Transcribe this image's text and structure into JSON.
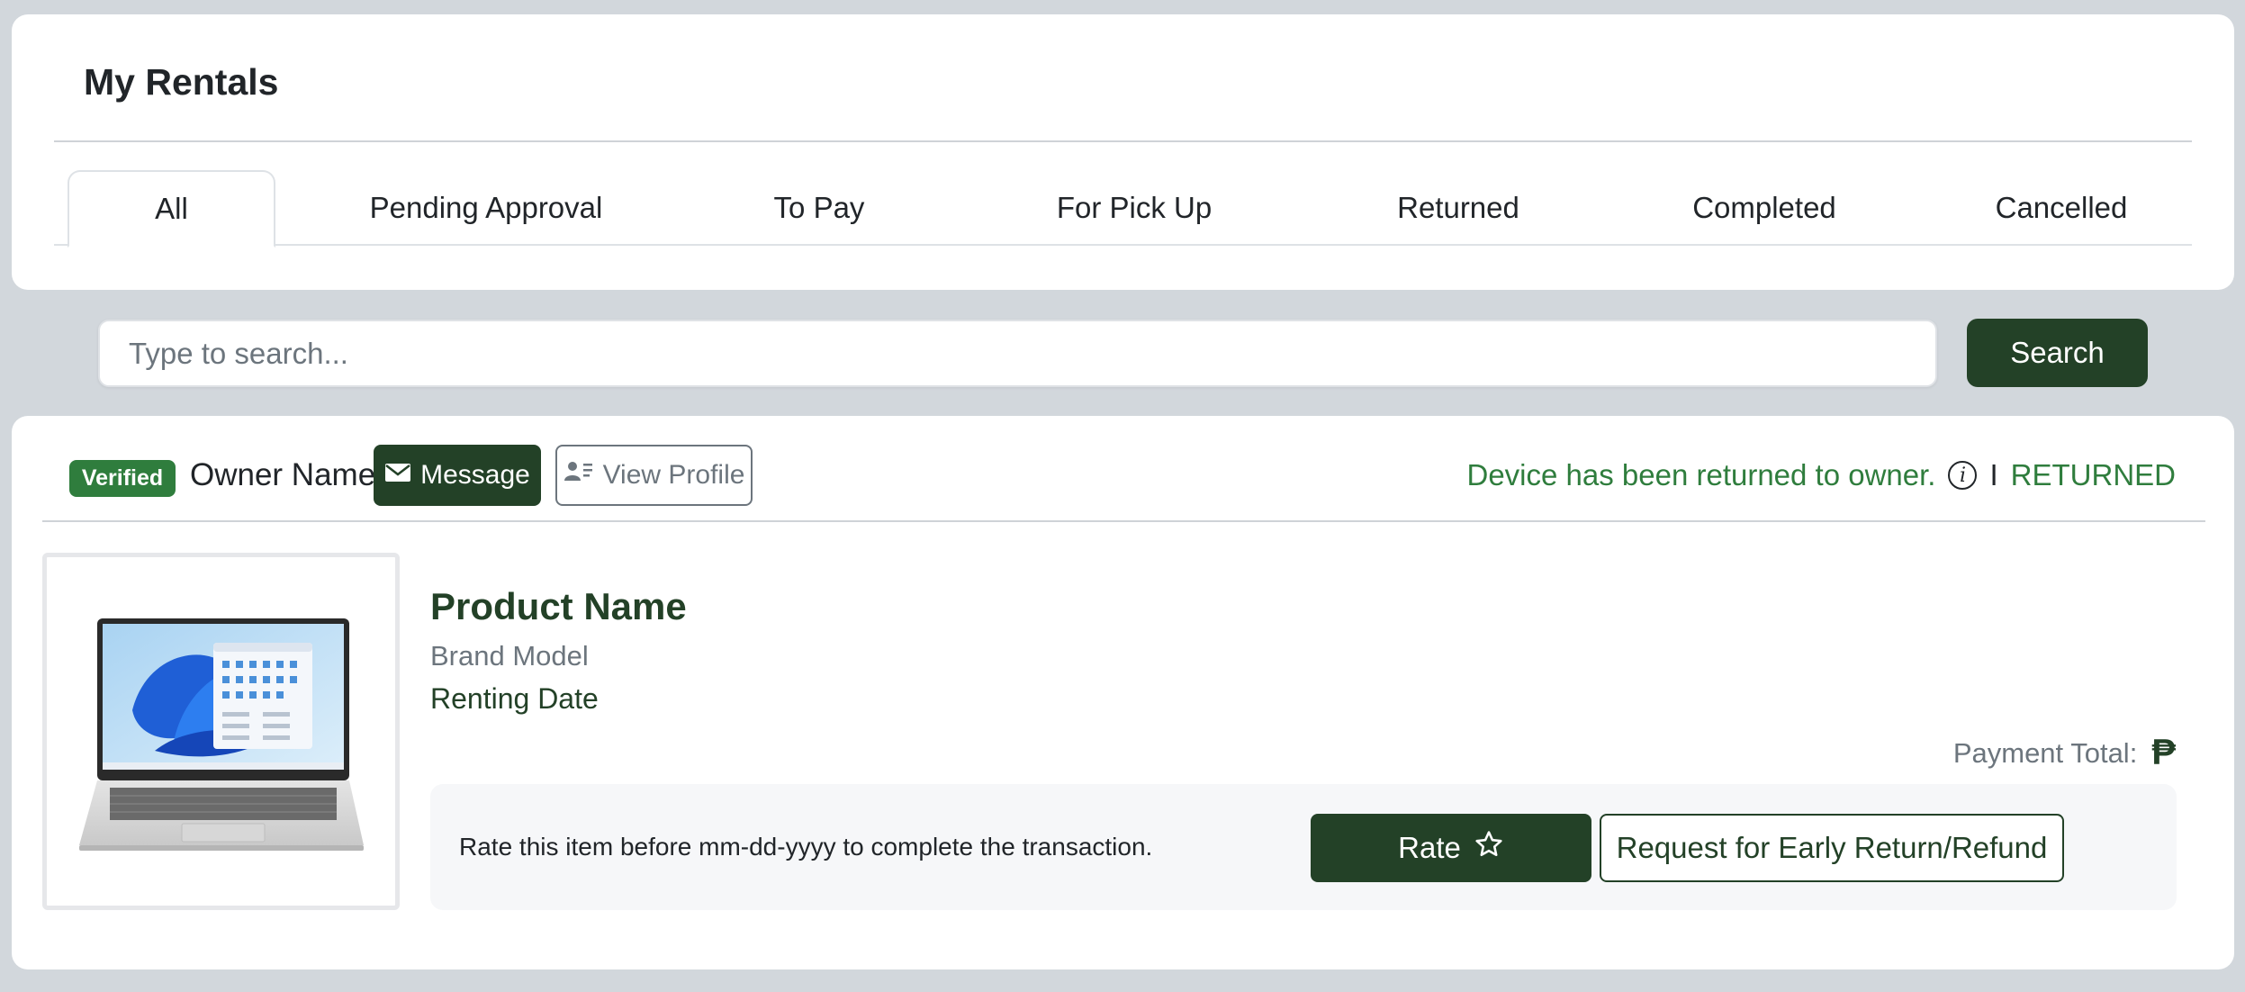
{
  "header": {
    "title": "My Rentals"
  },
  "tabs": [
    {
      "label": "All",
      "active": true
    },
    {
      "label": "Pending Approval",
      "active": false
    },
    {
      "label": "To Pay",
      "active": false
    },
    {
      "label": "For Pick Up",
      "active": false
    },
    {
      "label": "Returned",
      "active": false
    },
    {
      "label": "Completed",
      "active": false
    },
    {
      "label": "Cancelled",
      "active": false
    }
  ],
  "search": {
    "placeholder": "Type to search...",
    "button_label": "Search"
  },
  "rental": {
    "badge": "Verified",
    "owner_name": "Owner Name",
    "message_label": "Message",
    "view_profile_label": "View Profile",
    "status_message": "Device has been returned to owner.",
    "separator": "I",
    "status": "RETURNED",
    "product_name": "Product Name",
    "brand_model": "Brand Model",
    "renting_date": "Renting Date",
    "payment_label": "Payment Total:",
    "currency_symbol": "₱",
    "rate_prompt": "Rate this item before mm-dd-yyyy to complete the transaction.",
    "rate_label": "Rate",
    "refund_label": "Request for Early Return/Refund"
  },
  "colors": {
    "primary": "#234127",
    "success": "#2f7d3d",
    "muted": "#6c757d",
    "background": "#d2d7dc"
  },
  "icons": [
    "envelope-icon",
    "profile-card-icon",
    "info-icon",
    "star-icon",
    "laptop-image"
  ]
}
